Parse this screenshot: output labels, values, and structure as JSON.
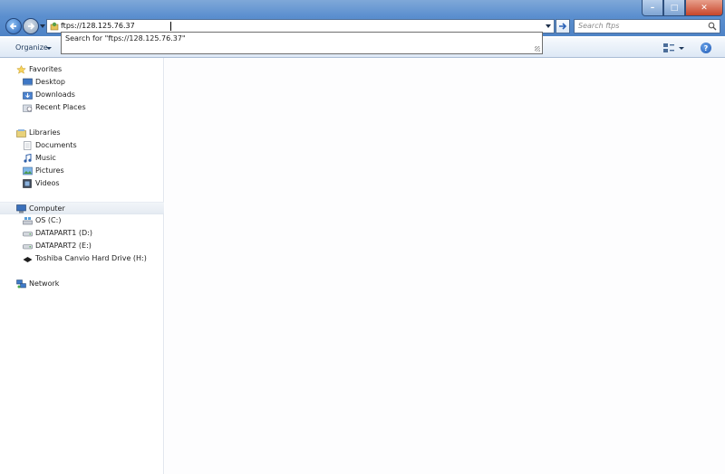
{
  "window": {
    "minimize": "–",
    "maximize": "□",
    "close": "✕"
  },
  "address": {
    "value": "ftps://128.125.76.37",
    "dropdown_icon": "chevron-down-icon"
  },
  "search": {
    "placeholder": "Search ftps"
  },
  "autocomplete": {
    "item": "Search for \"ftps://128.125.76.37\""
  },
  "toolbar": {
    "organize_label": "Organize",
    "help_label": "?"
  },
  "navpane": {
    "favorites": {
      "label": "Favorites",
      "items": [
        {
          "label": "Desktop"
        },
        {
          "label": "Downloads"
        },
        {
          "label": "Recent Places"
        }
      ]
    },
    "libraries": {
      "label": "Libraries",
      "items": [
        {
          "label": "Documents"
        },
        {
          "label": "Music"
        },
        {
          "label": "Pictures"
        },
        {
          "label": "Videos"
        }
      ]
    },
    "computer": {
      "label": "Computer",
      "items": [
        {
          "label": "OS (C:)"
        },
        {
          "label": "DATAPART1 (D:)"
        },
        {
          "label": "DATAPART2 (E:)"
        },
        {
          "label": "Toshiba Canvio Hard Drive (H:)"
        }
      ]
    },
    "network": {
      "label": "Network"
    }
  },
  "colors": {
    "title_gradient_top": "#7fa8d8",
    "title_gradient_bottom": "#4e83c6",
    "close_button": "#c7452a",
    "selected_row": "#e5ebf2"
  }
}
